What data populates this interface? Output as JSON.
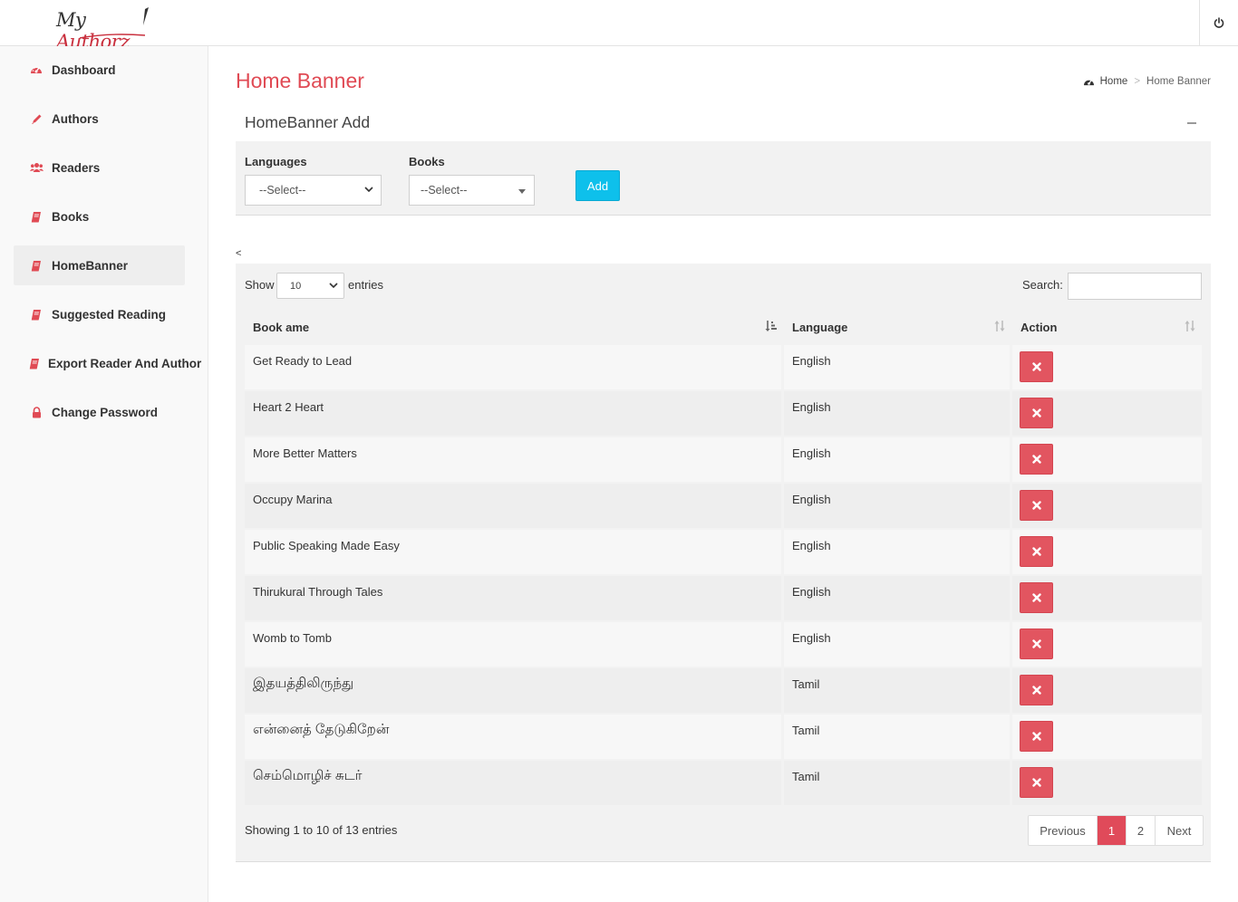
{
  "header": {
    "logo_text_1": "My",
    "logo_text_2": "Authorz"
  },
  "sidebar": {
    "items": [
      {
        "label": "Dashboard",
        "icon": "dashboard-icon"
      },
      {
        "label": "Authors",
        "icon": "pencil-icon"
      },
      {
        "label": "Readers",
        "icon": "users-icon"
      },
      {
        "label": "Books",
        "icon": "book-icon"
      },
      {
        "label": "HomeBanner",
        "icon": "book-icon",
        "active": true
      },
      {
        "label": "Suggested Reading",
        "icon": "book-icon"
      },
      {
        "label": "Export Reader And Author",
        "icon": "book-icon"
      },
      {
        "label": "Change Password",
        "icon": "lock-icon"
      }
    ]
  },
  "page": {
    "title": "Home Banner",
    "breadcrumb": {
      "home": "Home",
      "current": "Home Banner",
      "separator": ">"
    }
  },
  "add_form": {
    "box_title": "HomeBanner Add",
    "languages_label": "Languages",
    "languages_value": "--Select--",
    "books_label": "Books",
    "books_value": "--Select--",
    "add_label": "Add"
  },
  "stray_text": "<",
  "table": {
    "show_label": "Show",
    "page_size": "10",
    "entries_label": "entries",
    "search_label": "Search:",
    "search_value": "",
    "columns": [
      "Book ame",
      "Language",
      "Action"
    ],
    "rows": [
      {
        "book": "Get Ready to Lead",
        "language": "English"
      },
      {
        "book": "Heart 2 Heart",
        "language": "English"
      },
      {
        "book": "More Better Matters",
        "language": "English"
      },
      {
        "book": "Occupy Marina",
        "language": "English"
      },
      {
        "book": "Public Speaking Made Easy",
        "language": "English"
      },
      {
        "book": "Thirukural Through Tales",
        "language": "English"
      },
      {
        "book": "Womb to Tomb",
        "language": "English"
      },
      {
        "book": "இதயத்திலிருந்து",
        "language": "Tamil"
      },
      {
        "book": "என்னைத் தேடுகிறேன்",
        "language": "Tamil"
      },
      {
        "book": "செம்மொழிச் சுடர்",
        "language": "Tamil"
      }
    ],
    "info": "Showing 1 to 10 of 13 entries",
    "pagination": {
      "previous": "Previous",
      "pages": [
        "1",
        "2"
      ],
      "current": "1",
      "next": "Next"
    }
  },
  "colors": {
    "accent": "#e04a54",
    "add_button": "#0ec0eb",
    "delete_button": "#e25560"
  }
}
